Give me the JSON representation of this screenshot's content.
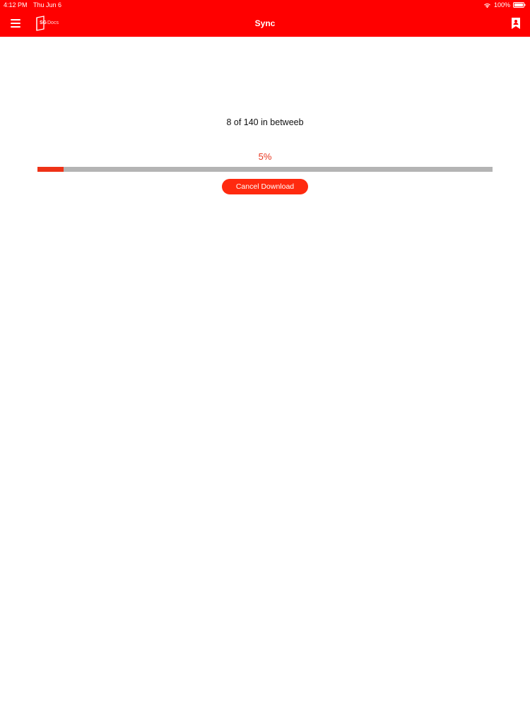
{
  "status_bar": {
    "time": "4:12 PM",
    "date": "Thu Jun 6",
    "battery_percent": "100%"
  },
  "nav_bar": {
    "title": "Sync",
    "logo_primary": "SG",
    "logo_secondary": "Docs"
  },
  "sync": {
    "status_text": "8 of 140 in betweeb",
    "progress_label": "5%",
    "progress_fraction": 0.058,
    "cancel_label": "Cancel Download"
  },
  "colors": {
    "brand_red": "#ff0000",
    "accent": "#e8351e",
    "track": "#b4b4b4"
  },
  "icons": {
    "menu": "hamburger-icon",
    "bookmark": "bookmark-user-icon",
    "wifi": "wifi-icon",
    "battery": "battery-icon"
  }
}
